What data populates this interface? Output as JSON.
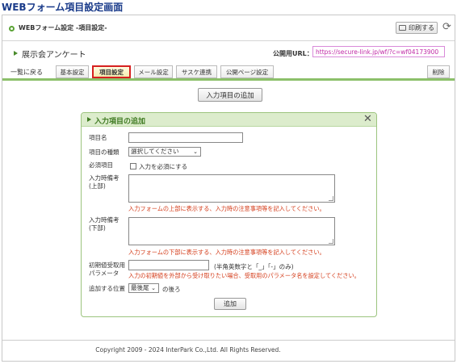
{
  "caption": "WEBフォーム項目設定画面",
  "header": {
    "title": "WEBフォーム設定 -項目設定-",
    "print_label": "印刷する"
  },
  "survey": {
    "name": "展示会アンケート",
    "url_label": "公開用URL：",
    "url_value": "https://secure-link.jp/wf/?c=wf04173900"
  },
  "tabs": {
    "back": "一覧に戻る",
    "items": [
      {
        "label": "基本設定",
        "active": false
      },
      {
        "label": "項目設定",
        "active": true
      },
      {
        "label": "メール設定",
        "active": false
      },
      {
        "label": "サスケ連携",
        "active": false
      },
      {
        "label": "公開ページ設定",
        "active": false
      }
    ],
    "delete": "削除"
  },
  "add_item_button": "入力項目の追加",
  "panel": {
    "title": "入力項目の追加",
    "fields": {
      "item_name_label": "項目名",
      "item_type_label": "項目の種類",
      "item_type_value": "選択してください",
      "required_label": "必須項目",
      "required_checkbox_label": "入力を必須にする",
      "note_top_label_1": "入力時備考",
      "note_top_label_2": "(上部)",
      "note_top_hint": "入力フォームの上部に表示する、入力時の注意事項等を記入してください。",
      "note_bottom_label_1": "入力時備考",
      "note_bottom_label_2": "(下部)",
      "note_bottom_hint": "入力フォームの下部に表示する、入力時の注意事項等を記入してください。",
      "param_label_1": "初期値受取用",
      "param_label_2": "パラメータ",
      "param_suffix": "(半角英数字と「_」「-」のみ)",
      "param_hint": "入力の初期値を外部から受け取りたい場合、受取用のパラメータ名を設定してください。",
      "position_label": "追加する位置",
      "position_value": "最後尾",
      "position_suffix": "の後ろ"
    },
    "submit_label": "追加"
  },
  "footer": "Copyright 2009 - 2024 InterPark Co.,Ltd. All Rights Reserved."
}
